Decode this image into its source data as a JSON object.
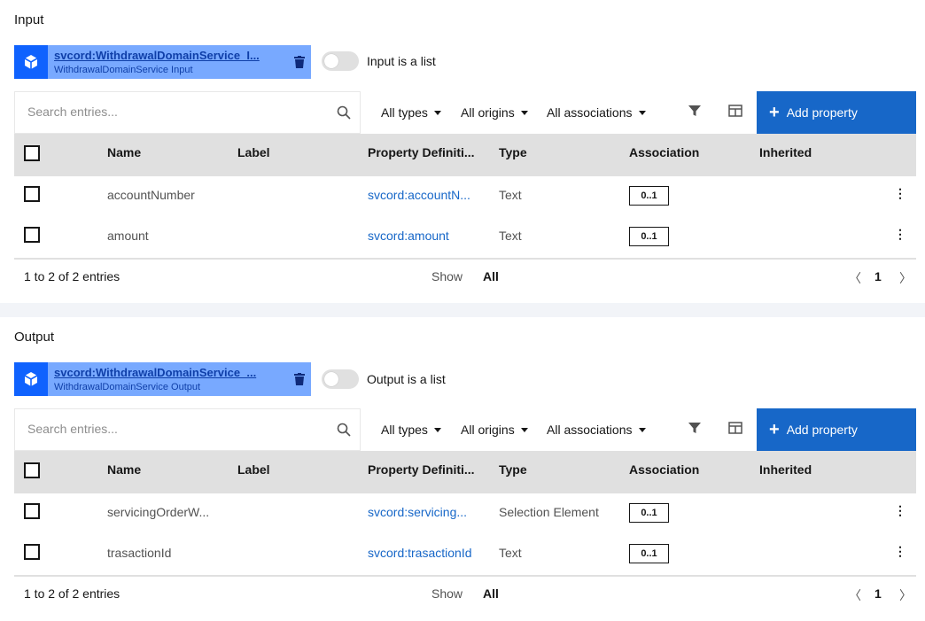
{
  "input": {
    "title": "Input",
    "chip": {
      "link": "svcord:WithdrawalDomainService_I...",
      "subtitle": "WithdrawalDomainService Input"
    },
    "toggle_label": "Input is a list",
    "search_placeholder": "Search entries...",
    "filters": [
      "All types",
      "All origins",
      "All associations"
    ],
    "add_button": "Add property",
    "columns": [
      "Name",
      "Label",
      "Property Definiti...",
      "Type",
      "Association",
      "Inherited"
    ],
    "rows": [
      {
        "name": "accountNumber",
        "label": "",
        "property": "svcord:accountN...",
        "type": "Text",
        "association": "0..1",
        "inherited": ""
      },
      {
        "name": "amount",
        "label": "",
        "property": "svcord:amount",
        "type": "Text",
        "association": "0..1",
        "inherited": ""
      }
    ],
    "footer": {
      "range": "1 to 2 of 2 entries",
      "show_label": "Show",
      "show_value": "All",
      "page": "1",
      "prev": "〈",
      "next": "〉"
    }
  },
  "output": {
    "title": "Output",
    "chip": {
      "link": "svcord:WithdrawalDomainService_...",
      "subtitle": "WithdrawalDomainService Output"
    },
    "toggle_label": "Output is a list",
    "search_placeholder": "Search entries...",
    "filters": [
      "All types",
      "All origins",
      "All associations"
    ],
    "add_button": "Add property",
    "columns": [
      "Name",
      "Label",
      "Property Definiti...",
      "Type",
      "Association",
      "Inherited"
    ],
    "rows": [
      {
        "name": "servicingOrderW...",
        "label": "",
        "property": "svcord:servicing...",
        "type": "Selection Element",
        "association": "0..1",
        "inherited": ""
      },
      {
        "name": "trasactionId",
        "label": "",
        "property": "svcord:trasactionId",
        "type": "Text",
        "association": "0..1",
        "inherited": ""
      }
    ],
    "footer": {
      "range": "1 to 2 of 2 entries",
      "show_label": "Show",
      "show_value": "All",
      "page": "1",
      "prev": "〈",
      "next": "〉"
    }
  },
  "colors": {
    "primary": "#1767c8",
    "chip_bg": "#78a9ff",
    "chip_icon_bg": "#0f62fe",
    "header_bg": "#e0e0e0"
  },
  "icons": [
    "cube-icon",
    "trash-icon",
    "search-icon",
    "filter-icon",
    "columns-icon",
    "plus-icon",
    "overflow-menu-icon"
  ]
}
